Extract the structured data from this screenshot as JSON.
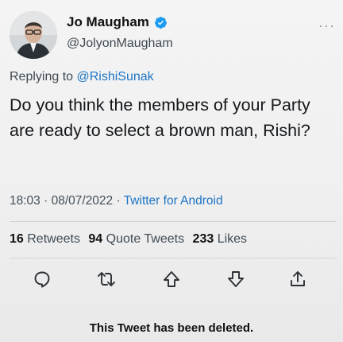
{
  "author": {
    "name": "Jo Maugham",
    "handle": "@JolyonMaugham",
    "verified": true,
    "verified_color": "#1d9bf0"
  },
  "more_label": "···",
  "reply_context": {
    "prefix": "Replying to",
    "mention": "@RishiSunak"
  },
  "tweet_text": "Do you think the members of your Party are ready to select a brown man, Rishi?",
  "meta": {
    "time": "18:03",
    "date": "08/07/2022",
    "separator": "·",
    "source": "Twitter for Android"
  },
  "stats": {
    "retweets_count": "16",
    "retweets_label": "Retweets",
    "quotes_count": "94",
    "quotes_label": "Quote Tweets",
    "likes_count": "233",
    "likes_label": "Likes"
  },
  "actions": [
    "reply-icon",
    "retweet-icon",
    "upvote-icon",
    "downvote-icon",
    "share-icon"
  ],
  "deleted_notice": "This Tweet has been deleted.",
  "colors": {
    "link": "#1d74c4",
    "text": "#15181b",
    "secondary": "#3f4a54"
  }
}
